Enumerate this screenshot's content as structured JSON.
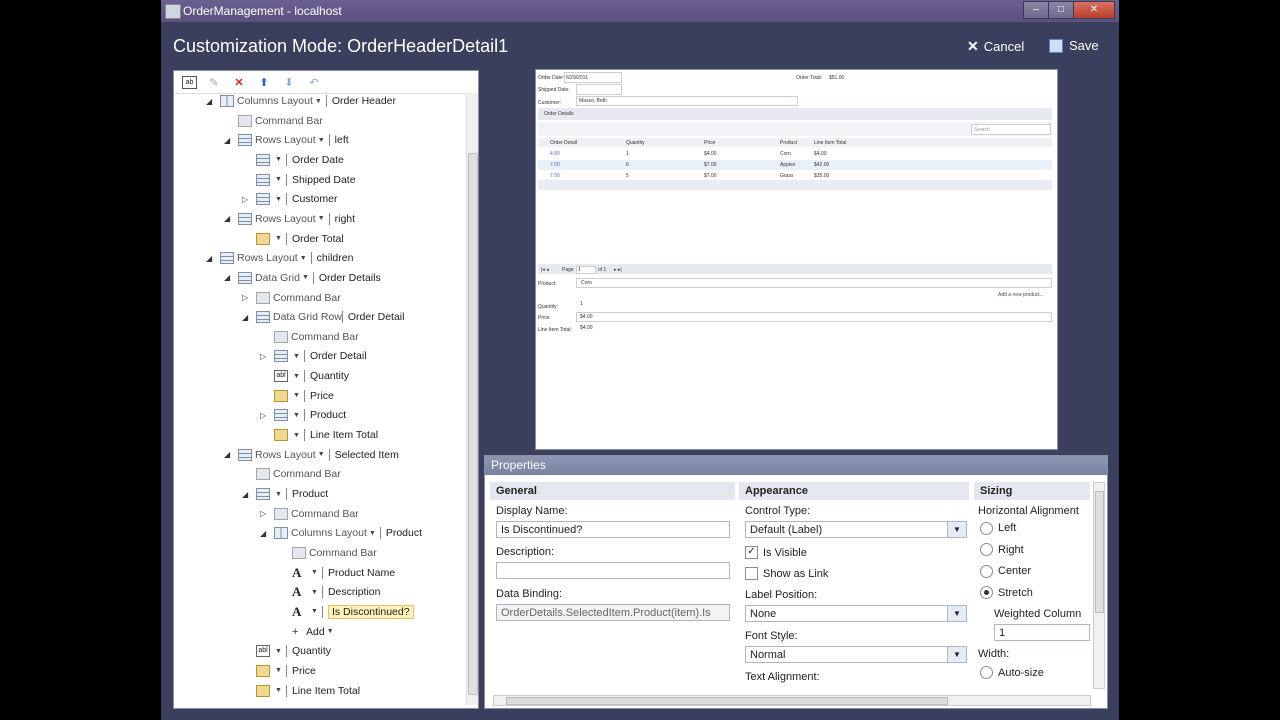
{
  "window": {
    "title": "OrderManagement - localhost",
    "min": "–",
    "max": "□",
    "close": "✕"
  },
  "header": {
    "title": "Customization Mode: OrderHeaderDetail1",
    "cancel": "Cancel",
    "save": "Save",
    "cancel_icon": "x-icon",
    "save_icon": "floppy-icon"
  },
  "toolbar": [
    "add-icon",
    "edit-icon",
    "delete-icon",
    "move-up-icon",
    "move-down-icon",
    "undo-icon"
  ],
  "tree": [
    {
      "indent": 0,
      "exp": "◢",
      "icon": "cols",
      "type": "Columns Layout",
      "name": "Order Header",
      "dd": true
    },
    {
      "indent": 1,
      "exp": "",
      "icon": "cmd",
      "type": "Command Bar",
      "name": "",
      "dd": false
    },
    {
      "indent": 1,
      "exp": "◢",
      "icon": "grid",
      "type": "Rows Layout",
      "name": "left",
      "dd": true
    },
    {
      "indent": 2,
      "exp": "",
      "icon": "grid",
      "type": "",
      "name": "Order Date",
      "dd": true
    },
    {
      "indent": 2,
      "exp": "",
      "icon": "grid",
      "type": "",
      "name": "Shipped Date",
      "dd": true
    },
    {
      "indent": 2,
      "exp": "▷",
      "icon": "grid",
      "type": "",
      "name": "Customer",
      "dd": true
    },
    {
      "indent": 1,
      "exp": "◢",
      "icon": "grid",
      "type": "Rows Layout",
      "name": "right",
      "dd": true
    },
    {
      "indent": 2,
      "exp": "",
      "icon": "money",
      "type": "",
      "name": "Order Total",
      "dd": true
    },
    {
      "indent": 0,
      "exp": "◢",
      "icon": "grid",
      "type": "Rows Layout",
      "name": "children",
      "dd": true
    },
    {
      "indent": 1,
      "exp": "◢",
      "icon": "grid",
      "type": "Data Grid",
      "name": "Order Details",
      "dd": true
    },
    {
      "indent": 2,
      "exp": "▷",
      "icon": "cmd",
      "type": "Command Bar",
      "name": "",
      "dd": false
    },
    {
      "indent": 2,
      "exp": "◢",
      "icon": "grid",
      "type": "Data Grid Row",
      "name": "Order Detail",
      "dd": false
    },
    {
      "indent": 3,
      "exp": "",
      "icon": "cmd",
      "type": "Command Bar",
      "name": "",
      "dd": false
    },
    {
      "indent": 3,
      "exp": "▷",
      "icon": "grid",
      "type": "",
      "name": "Order Detail",
      "dd": true
    },
    {
      "indent": 3,
      "exp": "",
      "icon": "abl",
      "type": "",
      "name": "Quantity",
      "dd": true
    },
    {
      "indent": 3,
      "exp": "",
      "icon": "money",
      "type": "",
      "name": "Price",
      "dd": true
    },
    {
      "indent": 3,
      "exp": "▷",
      "icon": "grid",
      "type": "",
      "name": "Product",
      "dd": true
    },
    {
      "indent": 3,
      "exp": "",
      "icon": "money",
      "type": "",
      "name": "Line Item Total",
      "dd": true
    },
    {
      "indent": 1,
      "exp": "◢",
      "icon": "grid",
      "type": "Rows Layout",
      "name": "Selected Item",
      "dd": true
    },
    {
      "indent": 2,
      "exp": "",
      "icon": "cmd",
      "type": "Command Bar",
      "name": "",
      "dd": false
    },
    {
      "indent": 2,
      "exp": "◢",
      "icon": "grid",
      "type": "",
      "name": "Product",
      "dd": true
    },
    {
      "indent": 3,
      "exp": "▷",
      "icon": "cmd",
      "type": "Command Bar",
      "name": "",
      "dd": false
    },
    {
      "indent": 3,
      "exp": "◢",
      "icon": "cols",
      "type": "Columns Layout",
      "name": "Product",
      "dd": true
    },
    {
      "indent": 4,
      "exp": "",
      "icon": "cmd",
      "type": "Command Bar",
      "name": "",
      "dd": false
    },
    {
      "indent": 4,
      "exp": "",
      "icon": "A",
      "type": "",
      "name": "Product Name",
      "dd": true
    },
    {
      "indent": 4,
      "exp": "",
      "icon": "A",
      "type": "",
      "name": "Description",
      "dd": true
    },
    {
      "indent": 4,
      "exp": "",
      "icon": "A",
      "type": "",
      "name": "Is Discontinued?",
      "dd": true,
      "selected": true
    },
    {
      "indent": 4,
      "exp": "",
      "icon": "add",
      "type": "",
      "name": "Add",
      "dd": true
    },
    {
      "indent": 2,
      "exp": "",
      "icon": "abl",
      "type": "",
      "name": "Quantity",
      "dd": true
    },
    {
      "indent": 2,
      "exp": "",
      "icon": "money",
      "type": "",
      "name": "Price",
      "dd": true
    },
    {
      "indent": 2,
      "exp": "",
      "icon": "money",
      "type": "",
      "name": "Line Item Total",
      "dd": true
    }
  ],
  "preview": {
    "order_date_label": "Order Date:",
    "order_date": "6/29/2011",
    "order_total_label": "Order Total:",
    "order_total": "$51.00",
    "shipped_label": "Shipped Date:",
    "customer_label": "Customer:",
    "customer": "Masso, Beth",
    "details_title": "Order Details",
    "search": "Search",
    "columns": [
      "Order Detail",
      "Quantity",
      "Price",
      "Product",
      "Line Item Total"
    ],
    "rows": [
      [
        "4.00",
        "1",
        "$4.00",
        "Corn",
        "$4.00"
      ],
      [
        "7.00",
        "6",
        "$7.00",
        "Apples",
        "$42.00"
      ],
      [
        "7.00",
        "5",
        "$7.00",
        "Grass",
        "$35.00"
      ]
    ],
    "page_label": "Page",
    "page_num": "1",
    "page_of": "of 1",
    "product_label": "Product:",
    "product_value": "Corn",
    "add_new": "Add a new product...",
    "quantity_label": "Quantity:",
    "quantity": "1",
    "price_label": "Price:",
    "price": "$4.00",
    "lit_label": "Line Item Total:",
    "lit": "$4.00"
  },
  "properties": {
    "title": "Properties",
    "general": {
      "heading": "General",
      "display_name_label": "Display Name:",
      "display_name": "Is Discontinued?",
      "description_label": "Description:",
      "description": "",
      "binding_label": "Data Binding:",
      "binding": "OrderDetails.SelectedItem.Product(item).Is"
    },
    "appearance": {
      "heading": "Appearance",
      "control_type_label": "Control Type:",
      "control_type": "Default (Label)",
      "is_visible": "Is Visible",
      "show_as_link": "Show as Link",
      "label_position_label": "Label Position:",
      "label_position": "None",
      "font_style_label": "Font Style:",
      "font_style": "Normal",
      "text_alignment_label": "Text Alignment:"
    },
    "sizing": {
      "heading": "Sizing",
      "h_align_label": "Horizontal Alignment",
      "options": [
        "Left",
        "Right",
        "Center",
        "Stretch"
      ],
      "selected": "Stretch",
      "weighted_label": "Weighted Column",
      "weighted": "1",
      "width_label": "Width:",
      "auto_size": "Auto-size"
    }
  }
}
